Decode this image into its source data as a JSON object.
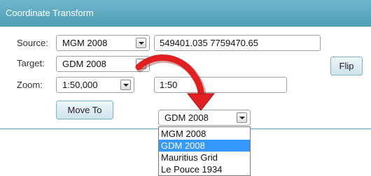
{
  "window": {
    "title": "Coordinate Transform"
  },
  "form": {
    "source_label": "Source:",
    "target_label": "Target:",
    "zoom_label": "Zoom:",
    "source_crs": "MGM 2008",
    "target_crs": "GDM 2008",
    "zoom_scale": "1:50,000",
    "source_coords": "549401.035 7759470.65",
    "target_coords": "1:50"
  },
  "buttons": {
    "flip": "Flip",
    "move_to": "Move To"
  },
  "dropdown": {
    "selected": "GDM 2008",
    "options": [
      "MGM 2008",
      "GDM 2008",
      "Mauritius Grid",
      "Le Pouce 1934"
    ],
    "highlighted_index": 1
  },
  "colors": {
    "header": "#4f9fb7",
    "arrow": "#e02020",
    "highlight": "#3399ff"
  }
}
